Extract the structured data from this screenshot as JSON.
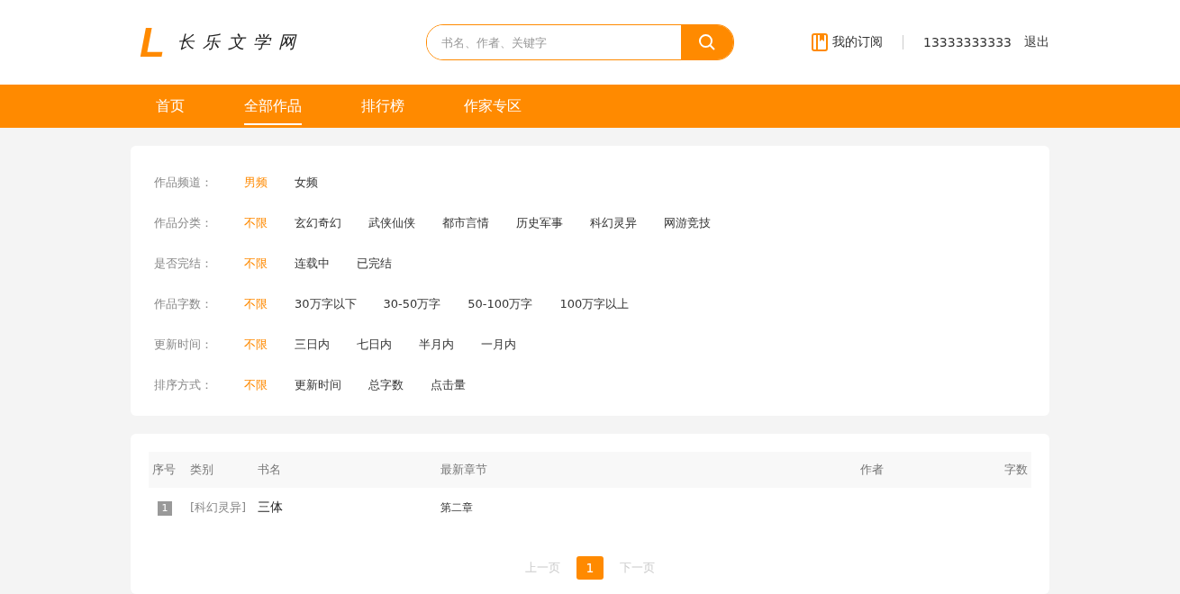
{
  "header": {
    "logo_mark": "L",
    "logo_text": "长乐文学网",
    "search": {
      "placeholder": "书名、作者、关键字"
    },
    "subscription": "我的订阅",
    "phone": "13333333333",
    "logout": "退出"
  },
  "nav": [
    {
      "label": "首页",
      "selected": false
    },
    {
      "label": "全部作品",
      "selected": true
    },
    {
      "label": "排行榜",
      "selected": false
    },
    {
      "label": "作家专区",
      "selected": false
    }
  ],
  "filters": [
    {
      "label": "作品频道：",
      "options": [
        {
          "label": "男频",
          "selected": true
        },
        {
          "label": "女频",
          "selected": false
        }
      ]
    },
    {
      "label": "作品分类：",
      "options": [
        {
          "label": "不限",
          "selected": true
        },
        {
          "label": "玄幻奇幻",
          "selected": false
        },
        {
          "label": "武侠仙侠",
          "selected": false
        },
        {
          "label": "都市言情",
          "selected": false
        },
        {
          "label": "历史军事",
          "selected": false
        },
        {
          "label": "科幻灵异",
          "selected": false
        },
        {
          "label": "网游竞技",
          "selected": false
        }
      ]
    },
    {
      "label": "是否完结：",
      "options": [
        {
          "label": "不限",
          "selected": true
        },
        {
          "label": "连载中",
          "selected": false
        },
        {
          "label": "已完结",
          "selected": false
        }
      ]
    },
    {
      "label": "作品字数：",
      "options": [
        {
          "label": "不限",
          "selected": true
        },
        {
          "label": "30万字以下",
          "selected": false
        },
        {
          "label": "30-50万字",
          "selected": false
        },
        {
          "label": "50-100万字",
          "selected": false
        },
        {
          "label": "100万字以上",
          "selected": false
        }
      ]
    },
    {
      "label": "更新时间：",
      "options": [
        {
          "label": "不限",
          "selected": true
        },
        {
          "label": "三日内",
          "selected": false
        },
        {
          "label": "七日内",
          "selected": false
        },
        {
          "label": "半月内",
          "selected": false
        },
        {
          "label": "一月内",
          "selected": false
        }
      ]
    },
    {
      "label": "排序方式：",
      "options": [
        {
          "label": "不限",
          "selected": true
        },
        {
          "label": "更新时间",
          "selected": false
        },
        {
          "label": "总字数",
          "selected": false
        },
        {
          "label": "点击量",
          "selected": false
        }
      ]
    }
  ],
  "table": {
    "columns": [
      "序号",
      "类别",
      "书名",
      "最新章节",
      "作者",
      "字数"
    ],
    "rows": [
      {
        "rank": "1",
        "category": "[科幻灵异]",
        "title": "三体",
        "latest_chapter": "第二章"
      }
    ]
  },
  "pagination": {
    "prev": {
      "label": "上一页",
      "disabled": true
    },
    "pages": [
      {
        "label": "1",
        "selected": true
      }
    ],
    "next": {
      "label": "下一页",
      "disabled": true
    }
  }
}
